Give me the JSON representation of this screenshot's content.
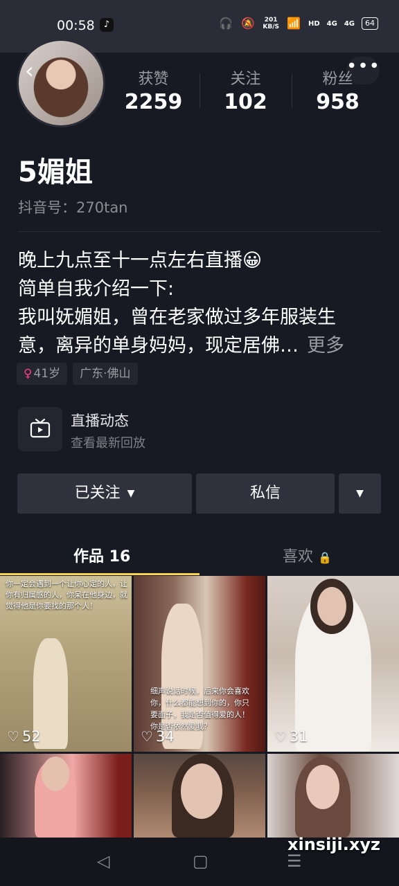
{
  "status_bar": {
    "time": "00:58",
    "app_icon": "tiktok-icon",
    "speed_value": "201",
    "speed_unit": "KB/S",
    "network_hd": "HD",
    "signal_1": "4G",
    "signal_2": "4G",
    "battery": "64"
  },
  "profile": {
    "name": "5媚姐",
    "douyin_id": "抖音号：270tan",
    "stats": [
      {
        "label": "获赞",
        "value": "2259"
      },
      {
        "label": "关注",
        "value": "102"
      },
      {
        "label": "粉丝",
        "value": "958"
      }
    ],
    "bio_lines": [
      "晚上九点至十一点左右直播😀",
      "简单自我介绍一下:",
      "我叫妩媚姐，曾在老家做过多年服装生",
      "意，离异的单身妈妈，现定居佛…"
    ],
    "bio_more": "更多",
    "tags": [
      {
        "icon": "female-icon",
        "icon_glyph": "♀",
        "label": "41岁"
      },
      {
        "label": "广东·佛山"
      }
    ]
  },
  "live": {
    "title": "直播动态",
    "subtitle": "查看最新回放"
  },
  "actions": {
    "follow_label": "已关注",
    "message_label": "私信"
  },
  "tabs": {
    "works": "作品 16",
    "likes": "喜欢"
  },
  "videos": [
    {
      "likes": "52",
      "caption": "你一定会遇到一个让你心定的人，让你有归属感的人，你呆在他身边，就觉得他是你要找的那个人！"
    },
    {
      "likes": "34",
      "caption": "细声说话时候，后来你会喜欢你，什么都能想到你的，你只要面子，我是否值得爱的人！你是否依然爱我？"
    },
    {
      "likes": "31",
      "caption": ""
    },
    {
      "likes": "",
      "caption": ""
    },
    {
      "likes": "",
      "caption": ""
    },
    {
      "likes": "",
      "caption": ""
    }
  ],
  "watermark": "xinsiji.xyz",
  "colors": {
    "background": "#161823",
    "follow_underline": "#fdd54c",
    "female_tag": "#ff3b87"
  }
}
